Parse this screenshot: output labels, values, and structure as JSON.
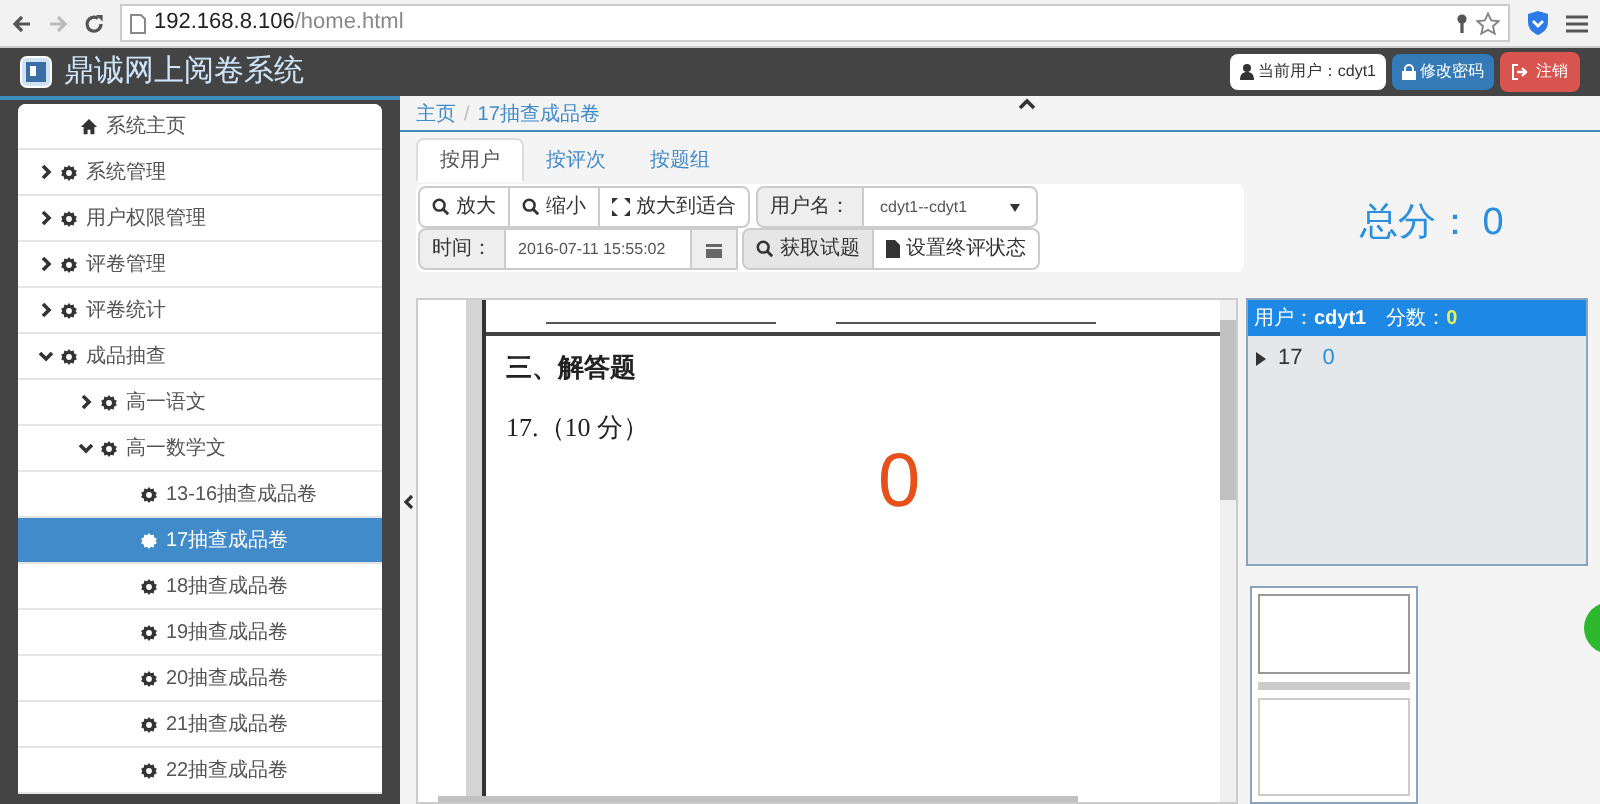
{
  "browser": {
    "url_host": "192.168.8.106",
    "url_path": "/home.html"
  },
  "header": {
    "title": "鼎诚网上阅卷系统",
    "current_user": "当前用户：cdyt1",
    "change_password": "修改密码",
    "logout": "注销"
  },
  "sidebar": {
    "items": [
      {
        "kind": "home",
        "label": "系统主页",
        "selected": false
      },
      {
        "kind": "group",
        "label": "系统管理",
        "expanded": false,
        "selected": false
      },
      {
        "kind": "group",
        "label": "用户权限管理",
        "expanded": false,
        "selected": false
      },
      {
        "kind": "group",
        "label": "评卷管理",
        "expanded": false,
        "selected": false
      },
      {
        "kind": "group",
        "label": "评卷统计",
        "expanded": false,
        "selected": false
      },
      {
        "kind": "group",
        "label": "成品抽查",
        "expanded": true,
        "selected": false,
        "children": [
          {
            "kind": "group",
            "label": "高一语文",
            "expanded": false,
            "selected": false
          },
          {
            "kind": "group",
            "label": "高一数学文",
            "expanded": true,
            "selected": false,
            "children": [
              {
                "kind": "item",
                "label": "13-16抽查成品卷",
                "selected": false
              },
              {
                "kind": "item",
                "label": "17抽查成品卷",
                "selected": true
              },
              {
                "kind": "item",
                "label": "18抽查成品卷",
                "selected": false
              },
              {
                "kind": "item",
                "label": "19抽查成品卷",
                "selected": false
              },
              {
                "kind": "item",
                "label": "20抽查成品卷",
                "selected": false
              },
              {
                "kind": "item",
                "label": "21抽查成品卷",
                "selected": false
              },
              {
                "kind": "item",
                "label": "22抽查成品卷",
                "selected": false
              }
            ]
          }
        ]
      }
    ]
  },
  "breadcrumb": {
    "separator": "/",
    "items": [
      "主页",
      "17抽查成品卷"
    ]
  },
  "tabs": [
    {
      "label": "按用户",
      "selected": true
    },
    {
      "label": "按评次",
      "selected": false
    },
    {
      "label": "按题组",
      "selected": false
    }
  ],
  "toolbar": {
    "zoom_in": "放大",
    "zoom_out": "缩小",
    "fit": "放大到适合",
    "username_label": "用户名：",
    "username_value": "cdyt1--cdyt1",
    "time_label": "时间：",
    "time_value": "2016-07-11 15:55:02",
    "fetch": "获取试题",
    "set_final": "设置终评状态"
  },
  "total": {
    "label": "总分：",
    "value": "0"
  },
  "document": {
    "section": "三、解答题",
    "question": "17.（10 分）",
    "mark": "0"
  },
  "score_panel": {
    "user_label": "用户：",
    "user": "cdyt1",
    "score_label": "分数：",
    "score": "0",
    "rows": [
      {
        "number": "17",
        "score": "0"
      }
    ]
  }
}
